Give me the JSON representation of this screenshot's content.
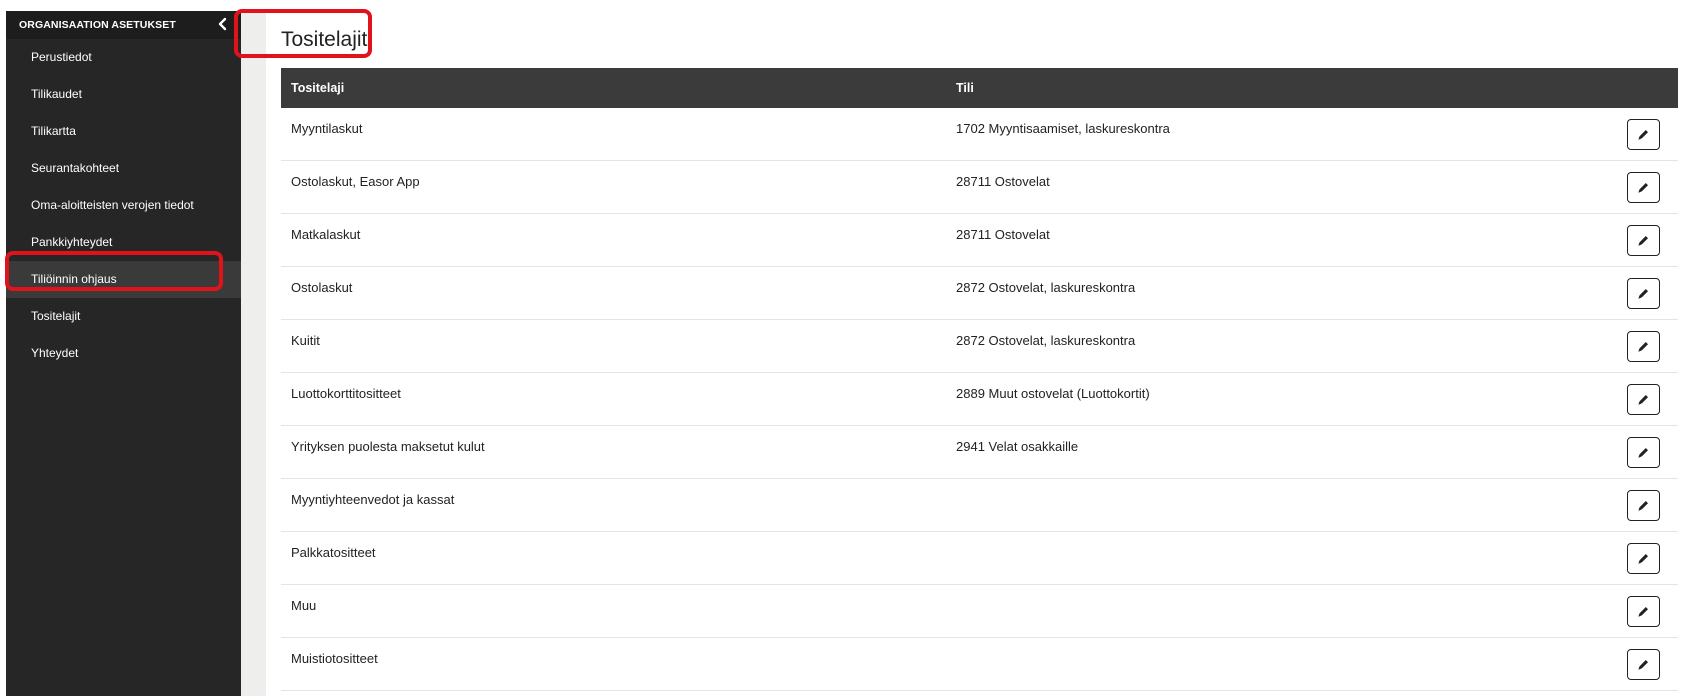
{
  "sidebar": {
    "title": "ORGANISAATION ASETUKSET",
    "collapse_icon": "chevron-left-icon",
    "items": [
      {
        "label": "Perustiedot"
      },
      {
        "label": "Tilikaudet"
      },
      {
        "label": "Tilikartta"
      },
      {
        "label": "Seurantakohteet"
      },
      {
        "label": "Oma-aloitteisten verojen tiedot"
      },
      {
        "label": "Pankkiyhteydet"
      },
      {
        "label": "Tiliöinnin ohjaus",
        "active": true
      },
      {
        "label": "Tositelajit"
      },
      {
        "label": "Yhteydet"
      }
    ]
  },
  "main": {
    "title": "Tositelajit",
    "table": {
      "headers": [
        "Tositelaji",
        "Tili"
      ],
      "edit_icon": "pencil-icon",
      "rows": [
        {
          "type": "Myyntilaskut",
          "account": "1702 Myyntisaamiset, laskureskontra"
        },
        {
          "type": "Ostolaskut, Easor App",
          "account": "28711 Ostovelat"
        },
        {
          "type": "Matkalaskut",
          "account": "28711 Ostovelat"
        },
        {
          "type": "Ostolaskut",
          "account": "2872 Ostovelat, laskureskontra"
        },
        {
          "type": "Kuitit",
          "account": "2872 Ostovelat, laskureskontra"
        },
        {
          "type": "Luottokorttitositteet",
          "account": "2889 Muut ostovelat (Luottokortit)"
        },
        {
          "type": "Yrityksen puolesta maksetut kulut",
          "account": "2941 Velat osakkaille"
        },
        {
          "type": "Myyntiyhteenvedot ja kassat",
          "account": ""
        },
        {
          "type": "Palkkatositteet",
          "account": ""
        },
        {
          "type": "Muu",
          "account": ""
        },
        {
          "type": "Muistiotositteet",
          "account": ""
        }
      ]
    }
  },
  "colors": {
    "sidebar_bg": "#262626",
    "table_header_bg": "#3b3b3b",
    "highlight": "#e0131d"
  }
}
